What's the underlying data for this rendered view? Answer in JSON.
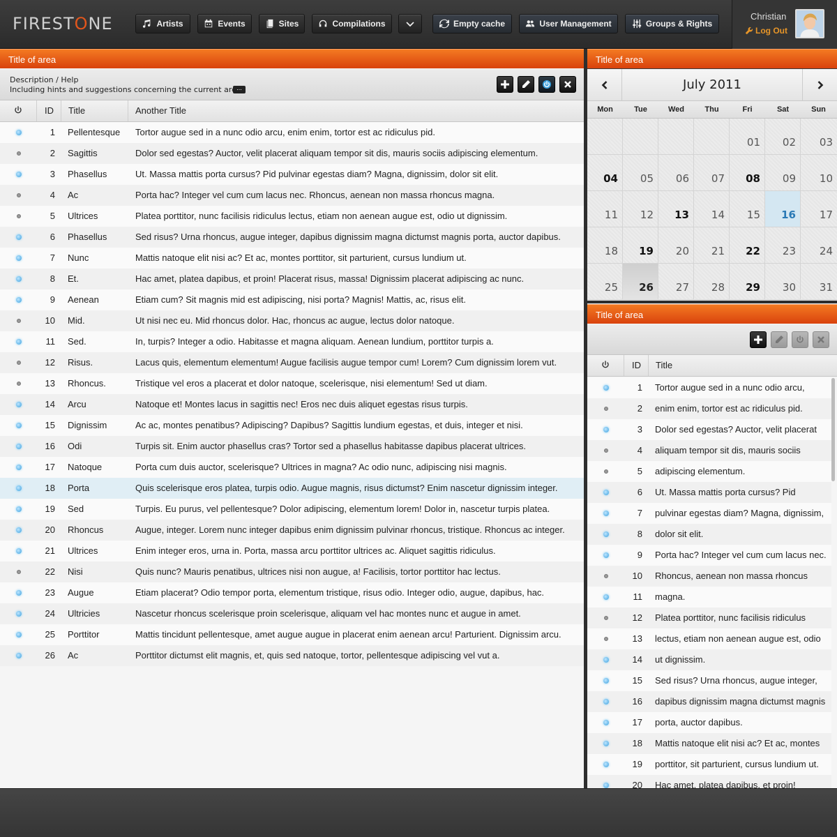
{
  "brand": {
    "logo_pre": "FIREST",
    "logo_o": "O",
    "logo_post": "NE"
  },
  "nav": {
    "artists": "Artists",
    "events": "Events",
    "sites": "Sites",
    "compilations": "Compilations",
    "empty_cache": "Empty cache",
    "user_management": "User Management",
    "groups_rights": "Groups & Rights"
  },
  "user": {
    "name": "Christian",
    "logout": "Log Out"
  },
  "colors": {
    "accent": "#e8561a",
    "active_blue": "#3aa0de"
  },
  "main": {
    "area_title": "Title of area",
    "desc_title": "Description / Help",
    "desc_sub": "Including hints and suggestions concerning the current area.",
    "more": "...",
    "columns": {
      "id": "ID",
      "title": "Title",
      "another": "Another Title"
    },
    "selected_id": 18,
    "rows": [
      {
        "id": "1",
        "active": true,
        "title": "Pellentesque",
        "another": "Tortor augue sed in a nunc odio arcu, enim enim, tortor est ac ridiculus pid."
      },
      {
        "id": "2",
        "active": false,
        "title": "Sagittis",
        "another": "Dolor sed egestas? Auctor, velit placerat aliquam tempor sit dis, mauris sociis adipiscing elementum."
      },
      {
        "id": "3",
        "active": true,
        "title": "Phasellus",
        "another": "Ut. Massa mattis porta cursus? Pid pulvinar egestas diam? Magna, dignissim, dolor sit elit."
      },
      {
        "id": "4",
        "active": false,
        "title": "Ac",
        "another": "Porta hac? Integer vel cum cum lacus nec. Rhoncus, aenean non massa rhoncus magna."
      },
      {
        "id": "5",
        "active": false,
        "title": "Ultrices",
        "another": "Platea porttitor, nunc facilisis ridiculus lectus, etiam non aenean augue est, odio ut dignissim."
      },
      {
        "id": "6",
        "active": true,
        "title": "Phasellus",
        "another": "Sed risus? Urna rhoncus, augue integer, dapibus dignissim magna dictumst magnis porta, auctor dapibus."
      },
      {
        "id": "7",
        "active": true,
        "title": "Nunc",
        "another": "Mattis natoque elit nisi ac? Et ac, montes porttitor, sit parturient, cursus lundium ut."
      },
      {
        "id": "8",
        "active": true,
        "title": "Et.",
        "another": "Hac amet, platea dapibus, et proin! Placerat risus, massa! Dignissim placerat adipiscing ac nunc."
      },
      {
        "id": "9",
        "active": true,
        "title": "Aenean",
        "another": "Etiam cum? Sit magnis mid est adipiscing, nisi porta? Magnis! Mattis, ac, risus elit."
      },
      {
        "id": "10",
        "active": false,
        "title": "Mid.",
        "another": "Ut nisi nec eu. Mid rhoncus dolor. Hac, rhoncus ac augue, lectus dolor natoque."
      },
      {
        "id": "11",
        "active": true,
        "title": "Sed.",
        "another": "In, turpis? Integer a odio. Habitasse et magna aliquam. Aenean lundium, porttitor turpis a."
      },
      {
        "id": "12",
        "active": false,
        "title": "Risus.",
        "another": "Lacus quis, elementum elementum! Augue facilisis augue tempor cum! Lorem? Cum dignissim lorem vut."
      },
      {
        "id": "13",
        "active": false,
        "title": "Rhoncus.",
        "another": "Tristique vel eros a placerat et dolor natoque, scelerisque, nisi elementum! Sed ut diam."
      },
      {
        "id": "14",
        "active": true,
        "title": "Arcu",
        "another": "Natoque et! Montes lacus in sagittis nec! Eros nec duis aliquet egestas risus turpis."
      },
      {
        "id": "15",
        "active": true,
        "title": "Dignissim",
        "another": "Ac ac, montes penatibus? Adipiscing? Dapibus? Sagittis lundium egestas, et duis, integer et nisi."
      },
      {
        "id": "16",
        "active": true,
        "title": "Odi",
        "another": "Turpis sit. Enim auctor phasellus cras? Tortor sed a phasellus habitasse dapibus placerat ultrices."
      },
      {
        "id": "17",
        "active": true,
        "title": "Natoque",
        "another": "Porta cum duis auctor, scelerisque? Ultrices in magna? Ac odio nunc, adipiscing nisi magnis."
      },
      {
        "id": "18",
        "active": true,
        "title": "Porta",
        "another": "Quis scelerisque eros platea, turpis odio. Augue magnis, risus dictumst? Enim nascetur dignissim integer."
      },
      {
        "id": "19",
        "active": true,
        "title": "Sed",
        "another": "Turpis. Eu purus, vel pellentesque? Dolor adipiscing, elementum lorem! Dolor in, nascetur turpis platea."
      },
      {
        "id": "20",
        "active": true,
        "title": "Rhoncus",
        "another": "Augue, integer. Lorem nunc integer dapibus enim dignissim pulvinar rhoncus, tristique. Rhoncus ac integer."
      },
      {
        "id": "21",
        "active": true,
        "title": "Ultrices",
        "another": "Enim integer eros, urna in. Porta, massa arcu porttitor ultrices ac. Aliquet sagittis ridiculus."
      },
      {
        "id": "22",
        "active": false,
        "title": "Nisi",
        "another": "Quis nunc? Mauris penatibus, ultrices nisi non augue, a! Facilisis, tortor porttitor hac lectus."
      },
      {
        "id": "23",
        "active": true,
        "title": "Augue",
        "another": "Etiam placerat? Odio tempor porta, elementum tristique, risus odio. Integer odio, augue, dapibus, hac."
      },
      {
        "id": "24",
        "active": true,
        "title": "Ultricies",
        "another": "Nascetur rhoncus scelerisque proin scelerisque, aliquam vel hac montes nunc et augue in amet."
      },
      {
        "id": "25",
        "active": true,
        "title": "Porttitor",
        "another": "Mattis tincidunt pellentesque, amet augue augue in placerat enim aenean arcu! Parturient. Dignissim arcu."
      },
      {
        "id": "26",
        "active": true,
        "title": "Ac",
        "another": "Porttitor dictumst elit magnis, et, quis sed natoque, tortor, pellentesque adipiscing vel vut a."
      }
    ]
  },
  "calendar": {
    "area_title": "Title of area",
    "month": "July 2011",
    "prev": "‹",
    "next": "›",
    "weekdays": [
      "Mon",
      "Tue",
      "Wed",
      "Thu",
      "Fri",
      "Sat",
      "Sun"
    ],
    "leading_blanks": 4,
    "days": [
      "01",
      "02",
      "03",
      "04",
      "05",
      "06",
      "07",
      "08",
      "09",
      "10",
      "11",
      "12",
      "13",
      "14",
      "15",
      "16",
      "17",
      "18",
      "19",
      "20",
      "21",
      "22",
      "23",
      "24",
      "25",
      "26",
      "27",
      "28",
      "29",
      "30",
      "31"
    ],
    "bold_days": [
      "04",
      "08",
      "13",
      "19",
      "22",
      "29"
    ],
    "today": "16",
    "selected": "26"
  },
  "side": {
    "area_title": "Title of area",
    "columns": {
      "id": "ID",
      "title": "Title"
    },
    "rows": [
      {
        "id": "1",
        "active": true,
        "title": "Tortor augue sed in a nunc odio arcu,"
      },
      {
        "id": "2",
        "active": false,
        "title": "enim enim, tortor est ac ridiculus pid."
      },
      {
        "id": "3",
        "active": true,
        "title": "Dolor sed egestas? Auctor, velit placerat"
      },
      {
        "id": "4",
        "active": false,
        "title": "aliquam tempor sit dis, mauris sociis"
      },
      {
        "id": "5",
        "active": false,
        "title": "adipiscing elementum."
      },
      {
        "id": "6",
        "active": true,
        "title": "Ut. Massa mattis porta cursus? Pid"
      },
      {
        "id": "7",
        "active": true,
        "title": "pulvinar egestas diam? Magna, dignissim,"
      },
      {
        "id": "8",
        "active": true,
        "title": "dolor sit elit."
      },
      {
        "id": "9",
        "active": true,
        "title": "Porta hac? Integer vel cum cum lacus nec."
      },
      {
        "id": "10",
        "active": false,
        "title": "Rhoncus, aenean non massa rhoncus"
      },
      {
        "id": "11",
        "active": true,
        "title": "magna."
      },
      {
        "id": "12",
        "active": false,
        "title": "Platea porttitor, nunc facilisis ridiculus"
      },
      {
        "id": "13",
        "active": false,
        "title": "lectus, etiam non aenean augue est, odio"
      },
      {
        "id": "14",
        "active": true,
        "title": "ut dignissim."
      },
      {
        "id": "15",
        "active": true,
        "title": "Sed risus? Urna rhoncus, augue integer,"
      },
      {
        "id": "16",
        "active": true,
        "title": "dapibus dignissim magna dictumst magnis"
      },
      {
        "id": "17",
        "active": true,
        "title": "porta, auctor dapibus."
      },
      {
        "id": "18",
        "active": true,
        "title": "Mattis natoque elit nisi ac? Et ac, montes"
      },
      {
        "id": "19",
        "active": true,
        "title": "porttitor, sit parturient, cursus lundium ut."
      },
      {
        "id": "20",
        "active": true,
        "title": "Hac amet, platea dapibus, et proin!"
      }
    ]
  }
}
